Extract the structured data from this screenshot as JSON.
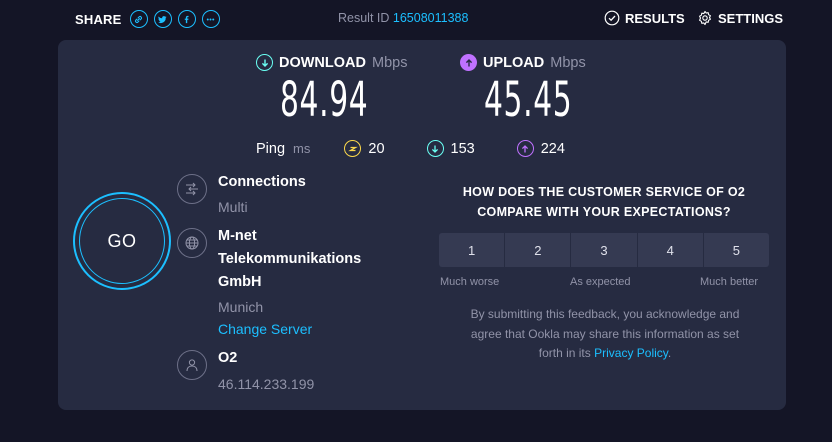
{
  "topbar": {
    "share_label": "SHARE",
    "share_icons": [
      "link-icon",
      "twitter-icon",
      "facebook-icon",
      "more-icon"
    ],
    "result_label": "Result ID",
    "result_id": "16508011388",
    "results_label": "RESULTS",
    "settings_label": "SETTINGS"
  },
  "download": {
    "label": "DOWNLOAD",
    "unit": "Mbps",
    "value": "84.94",
    "color": "#6afff3"
  },
  "upload": {
    "label": "UPLOAD",
    "unit": "Mbps",
    "value": "45.45",
    "color": "#bf71ff"
  },
  "ping": {
    "label": "Ping",
    "unit": "ms",
    "idle": "20",
    "download": "153",
    "upload": "224",
    "idle_color": "#fbd84b"
  },
  "go_label": "GO",
  "connections": {
    "title": "Connections",
    "value": "Multi"
  },
  "server": {
    "name_lines": [
      "M-net",
      "Telekommunikations",
      "GmbH"
    ],
    "location": "Munich",
    "change_label": "Change Server"
  },
  "provider": {
    "name": "O2",
    "ip": "46.114.233.199"
  },
  "survey": {
    "question_lines": [
      "HOW DOES THE CUSTOMER SERVICE OF O2",
      "COMPARE WITH YOUR EXPECTATIONS?"
    ],
    "options": [
      "1",
      "2",
      "3",
      "4",
      "5"
    ],
    "scale_low": "Much worse",
    "scale_mid": "As expected",
    "scale_high": "Much better",
    "disclaimer_lines": [
      "By submitting this feedback, you acknowledge and",
      "agree that Ookla may share this information as set",
      "forth in its"
    ],
    "privacy_link": "Privacy Policy",
    "privacy_suffix": "."
  },
  "colors": {
    "accent": "#1cbfff",
    "background": "#141526",
    "panel": "#262b41"
  }
}
